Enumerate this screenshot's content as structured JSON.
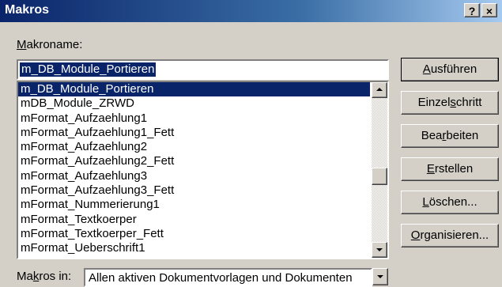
{
  "window": {
    "title": "Makros",
    "help_button": "?",
    "close_button": "×"
  },
  "macro_name": {
    "label_hotkey": "M",
    "label_rest": "akroname:",
    "value": "m_DB_Module_Portieren"
  },
  "macro_list": {
    "selected_index": 0,
    "items": [
      "m_DB_Module_Portieren",
      "mDB_Module_ZRWD",
      "mFormat_Aufzaehlung1",
      "mFormat_Aufzaehlung1_Fett",
      "mFormat_Aufzaehlung2",
      "mFormat_Aufzaehlung2_Fett",
      "mFormat_Aufzaehlung3",
      "mFormat_Aufzaehlung3_Fett",
      "mFormat_Nummerierung1",
      "mFormat_Textkoerper",
      "mFormat_Textkoerper_Fett",
      "mFormat_Ueberschrift1"
    ]
  },
  "buttons": {
    "run": {
      "pre": "",
      "hotkey": "A",
      "post": "usführen"
    },
    "step": {
      "pre": "Einzel",
      "hotkey": "s",
      "post": "chritt"
    },
    "edit": {
      "pre": "Bea",
      "hotkey": "r",
      "post": "beiten"
    },
    "create": {
      "pre": "",
      "hotkey": "E",
      "post": "rstellen"
    },
    "delete": {
      "pre": "",
      "hotkey": "L",
      "post": "öschen..."
    },
    "organize": {
      "pre": "",
      "hotkey": "O",
      "post": "rganisieren..."
    }
  },
  "macros_in": {
    "label_pre": "Ma",
    "label_hotkey": "k",
    "label_post": "ros in:",
    "value": "Allen aktiven Dokumentvorlagen und Dokumenten"
  },
  "scrollbar": {
    "position": 0.55
  }
}
